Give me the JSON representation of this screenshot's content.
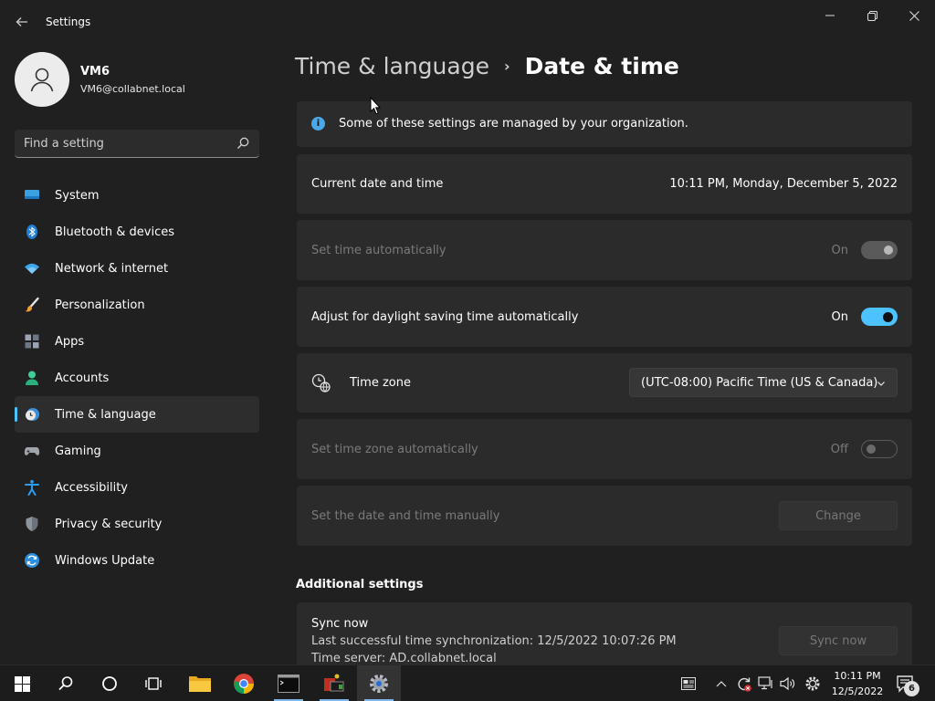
{
  "window": {
    "title": "Settings",
    "controls": {
      "minimize": "—",
      "maximize": "❐",
      "close": "✕"
    }
  },
  "profile": {
    "name": "VM6",
    "email": "VM6@collabnet.local"
  },
  "search": {
    "placeholder": "Find a setting"
  },
  "sidebar": {
    "items": [
      {
        "label": "System",
        "icon": "monitor-icon"
      },
      {
        "label": "Bluetooth & devices",
        "icon": "bluetooth-icon"
      },
      {
        "label": "Network & internet",
        "icon": "wifi-icon"
      },
      {
        "label": "Personalization",
        "icon": "brush-icon"
      },
      {
        "label": "Apps",
        "icon": "apps-icon"
      },
      {
        "label": "Accounts",
        "icon": "person-icon"
      },
      {
        "label": "Time & language",
        "icon": "clock-globe-icon",
        "active": true
      },
      {
        "label": "Gaming",
        "icon": "gamepad-icon"
      },
      {
        "label": "Accessibility",
        "icon": "accessibility-icon"
      },
      {
        "label": "Privacy & security",
        "icon": "shield-icon"
      },
      {
        "label": "Windows Update",
        "icon": "update-icon"
      }
    ]
  },
  "breadcrumb": {
    "parent": "Time & language",
    "separator": "›",
    "current": "Date & time"
  },
  "main": {
    "info_banner": "Some of these settings are managed by your organization.",
    "current_datetime": {
      "label": "Current date and time",
      "value": "10:11 PM, Monday, December 5, 2022"
    },
    "set_time_auto": {
      "label": "Set time automatically",
      "state": "On"
    },
    "daylight_saving": {
      "label": "Adjust for daylight saving time automatically",
      "state": "On"
    },
    "time_zone": {
      "label": "Time zone",
      "value": "(UTC-08:00) Pacific Time (US & Canada)"
    },
    "set_tz_auto": {
      "label": "Set time zone automatically",
      "state": "Off"
    },
    "manual": {
      "label": "Set the date and time manually",
      "button": "Change"
    },
    "additional_title": "Additional settings",
    "sync": {
      "title": "Sync now",
      "last_sync": "Last successful time synchronization: 12/5/2022 10:07:26 PM",
      "server": "Time server: AD.collabnet.local",
      "button": "Sync now"
    }
  },
  "taskbar": {
    "clock_time": "10:11 PM",
    "clock_date": "12/5/2022",
    "notification_count": "6"
  },
  "colors": {
    "accent": "#4cc2ff",
    "background": "#202020",
    "card": "#2b2b2b"
  }
}
